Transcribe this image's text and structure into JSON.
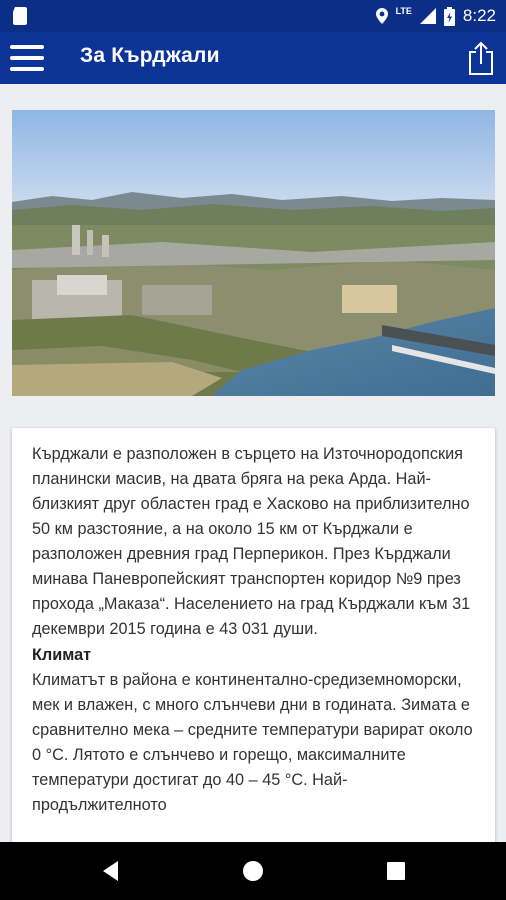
{
  "status_bar": {
    "time": "8:22",
    "network_label": "LTE",
    "icons": [
      "sim-card-icon",
      "location-icon",
      "signal-icon",
      "battery-icon"
    ]
  },
  "app_bar": {
    "title": "За Кърджали",
    "menu_icon": "hamburger-menu-icon",
    "share_icon": "share-icon"
  },
  "article": {
    "image": "aerial-city-photo",
    "intro": "Кърджали е разположен в сърцето на Източнородопския планински масив, на двата бряга на река Арда. Най-близкият друг областен град е Хасково на приблизително 50 км разстояние, а на около 15 км от Кърджали е разположен древния град Перперикон. През Кърджали минава Паневропейският транспортен коридор №9 през прохода „Маказа“. Населението на град Кърджали към 31 декември 2015 година е 43 031 души.",
    "climate_heading": "Климат",
    "climate_text": "Климатът в района е континентално-средиземноморски, мек и влажен, с много слънчеви дни в годината. Зимата е сравнително мека – средните температури варират около 0 °C. Лятото е слънчево и горещо, максималните температури достигат до 40 – 45 °C. Най-продължителното"
  },
  "nav_bar": {
    "buttons": [
      "back-icon",
      "home-icon",
      "recents-icon"
    ]
  },
  "colors": {
    "status_bar": "#0b2f86",
    "app_bar": "#0c3497",
    "background": "#eceef1"
  }
}
